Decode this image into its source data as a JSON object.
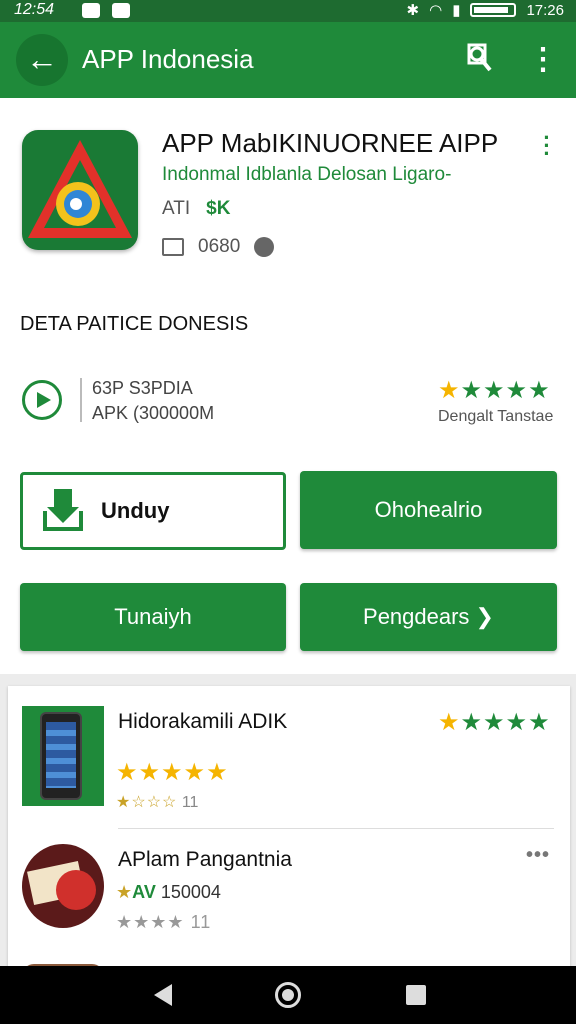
{
  "status_bar": {
    "time": "12:54",
    "clock_right": "17:26"
  },
  "app_bar": {
    "title": "APP Indonesia"
  },
  "app_card": {
    "name": "APP MabIKINUORNEE AIPP",
    "subtitle": "Indonmal Idblanla Delosan Ligaro-",
    "meta_prefix": "ATI",
    "meta_highlight": "$K",
    "meta_value": "0680"
  },
  "details": {
    "section_title": "DETA PAITICE DONESIS",
    "line1": "63P S3PDIA",
    "line2": "APK (300000M",
    "rating_stars": "★★★★★",
    "rating_label": "Dengalt Tanstae"
  },
  "buttons": {
    "download": "Unduy",
    "secondary": "Ohohealrio",
    "primary": "Tunaiyh",
    "next": "Pengdears ❯"
  },
  "list": {
    "items": [
      {
        "title": "Hidorakamili ADIK",
        "stars_right": "★★★★★",
        "stars": "★★★★★",
        "meta_stars": "★☆☆☆",
        "meta_count": "11"
      },
      {
        "title": "APlam Pangantnia",
        "sub_star": "★",
        "sub_mark": "A",
        "sub_extra": "V",
        "sub_value": "150004",
        "meta_stars": "★★★★",
        "meta_count": "11"
      }
    ]
  },
  "colors": {
    "primary_green": "#1f8a3a",
    "dark_green": "#1e6b30",
    "star_gold": "#f5b400"
  }
}
